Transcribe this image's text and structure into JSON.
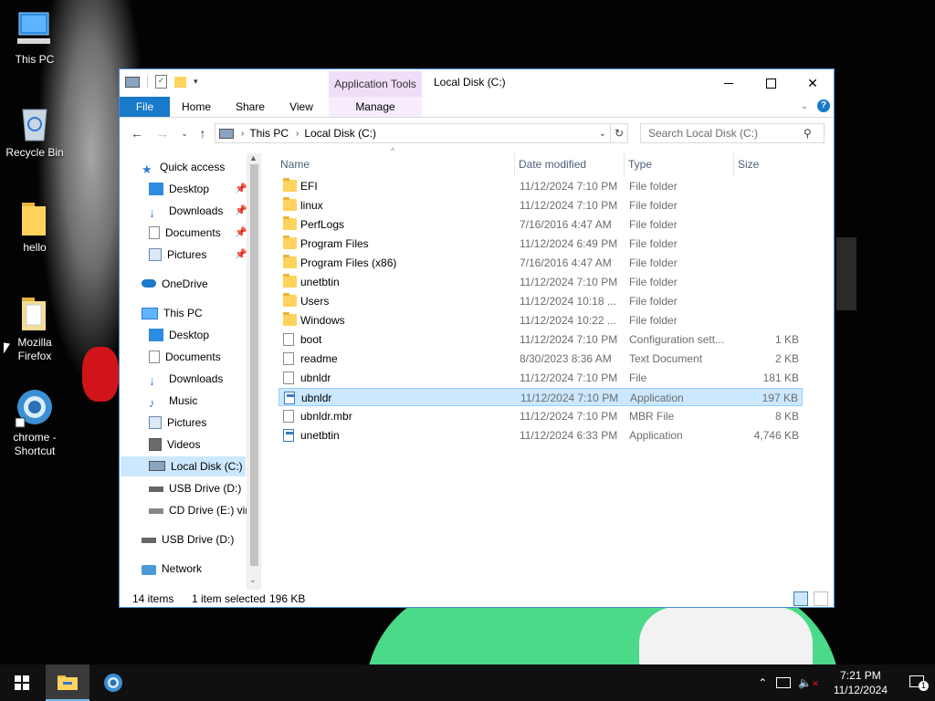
{
  "desktop": {
    "icons": [
      {
        "label": "This PC"
      },
      {
        "label": "Recycle Bin"
      },
      {
        "label": "hello"
      },
      {
        "label": "Mozilla Firefox"
      },
      {
        "label": "chrome - Shortcut"
      }
    ]
  },
  "window": {
    "context_tab": "Application Tools",
    "title": "Local Disk (C:)",
    "ribbon_tabs": {
      "file": "File",
      "home": "Home",
      "share": "Share",
      "view": "View",
      "manage": "Manage"
    },
    "address": {
      "crumb1": "This PC",
      "crumb2": "Local Disk (C:)"
    },
    "search": {
      "placeholder": "Search Local Disk (C:)"
    },
    "nav": {
      "quick_access": "Quick access",
      "qa_desktop": "Desktop",
      "qa_downloads": "Downloads",
      "qa_documents": "Documents",
      "qa_pictures": "Pictures",
      "onedrive": "OneDrive",
      "this_pc": "This PC",
      "pc_desktop": "Desktop",
      "pc_documents": "Documents",
      "pc_downloads": "Downloads",
      "pc_music": "Music",
      "pc_pictures": "Pictures",
      "pc_videos": "Videos",
      "local_disk": "Local Disk (C:)",
      "usb_sub": "USB Drive (D:)",
      "cd_drive": "CD Drive (E:) virt",
      "usb_root": "USB Drive (D:)",
      "network": "Network"
    },
    "columns": {
      "name": "Name",
      "date": "Date modified",
      "type": "Type",
      "size": "Size"
    },
    "files": [
      {
        "name": "EFI",
        "date": "11/12/2024 7:10 PM",
        "type": "File folder",
        "size": "",
        "icon": "folder"
      },
      {
        "name": "linux",
        "date": "11/12/2024 7:10 PM",
        "type": "File folder",
        "size": "",
        "icon": "folder"
      },
      {
        "name": "PerfLogs",
        "date": "7/16/2016 4:47 AM",
        "type": "File folder",
        "size": "",
        "icon": "folder"
      },
      {
        "name": "Program Files",
        "date": "11/12/2024 6:49 PM",
        "type": "File folder",
        "size": "",
        "icon": "folder"
      },
      {
        "name": "Program Files (x86)",
        "date": "7/16/2016 4:47 AM",
        "type": "File folder",
        "size": "",
        "icon": "folder"
      },
      {
        "name": "unetbtin",
        "date": "11/12/2024 7:10 PM",
        "type": "File folder",
        "size": "",
        "icon": "folder"
      },
      {
        "name": "Users",
        "date": "11/12/2024 10:18 ...",
        "type": "File folder",
        "size": "",
        "icon": "folder"
      },
      {
        "name": "Windows",
        "date": "11/12/2024 10:22 ...",
        "type": "File folder",
        "size": "",
        "icon": "folder"
      },
      {
        "name": "boot",
        "date": "11/12/2024 7:10 PM",
        "type": "Configuration sett...",
        "size": "1 KB",
        "icon": "config"
      },
      {
        "name": "readme",
        "date": "8/30/2023 8:36 AM",
        "type": "Text Document",
        "size": "2 KB",
        "icon": "doc"
      },
      {
        "name": "ubnldr",
        "date": "11/12/2024 7:10 PM",
        "type": "File",
        "size": "181 KB",
        "icon": "doc"
      },
      {
        "name": "ubnldr",
        "date": "11/12/2024 7:10 PM",
        "type": "Application",
        "size": "197 KB",
        "icon": "app",
        "selected": true
      },
      {
        "name": "ubnldr.mbr",
        "date": "11/12/2024 7:10 PM",
        "type": "MBR File",
        "size": "8 KB",
        "icon": "doc"
      },
      {
        "name": "unetbtin",
        "date": "11/12/2024 6:33 PM",
        "type": "Application",
        "size": "4,746 KB",
        "icon": "app"
      }
    ],
    "status": {
      "count": "14 items",
      "selected": "1 item selected",
      "size": "196 KB"
    }
  },
  "taskbar": {
    "time": "7:21 PM",
    "date": "11/12/2024",
    "notification_count": "1"
  },
  "colors": {
    "accent": "#1979ca",
    "selection": "#cce8ff",
    "folder": "#ffd35c"
  }
}
